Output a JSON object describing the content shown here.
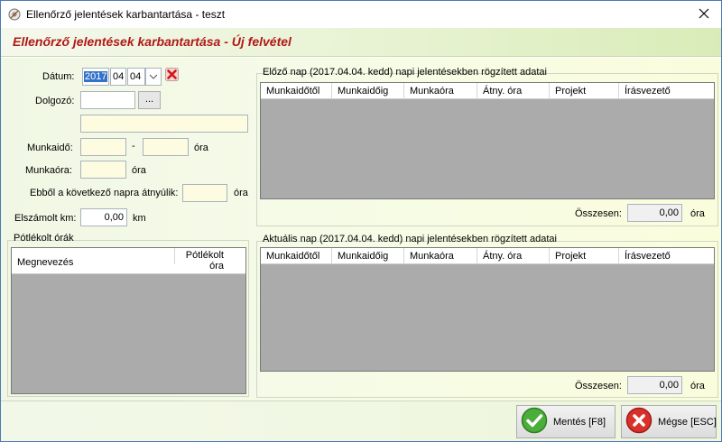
{
  "window": {
    "title": "Ellenőrző jelentések karbantartása - teszt",
    "heading": "Ellenőrző jelentések karbantartása - Új felvétel"
  },
  "form": {
    "datum_label": "Dátum:",
    "date_year": "2017",
    "date_month": "04",
    "date_day": "04",
    "dolgozo_label": "Dolgozó:",
    "dolgozo_code": "",
    "browse_label": "...",
    "dolgozo_name": "",
    "munkaido_label": "Munkaidő:",
    "munkaido_from": "",
    "munkaido_sep": "-",
    "munkaido_to": "",
    "munkaido_unit": "óra",
    "munkaora_label": "Munkaóra:",
    "munkaora_value": "",
    "munkaora_unit": "óra",
    "atnyulik_label": "Ebből a következő napra átnyúlik:",
    "atnyulik_value": "",
    "atnyulik_unit": "óra",
    "km_label": "Elszámolt km:",
    "km_value": "0,00",
    "km_unit": "km"
  },
  "potlek": {
    "title": "Pótlékolt órák",
    "col_name": "Megnevezés",
    "col_hours_1": "Pótlékolt",
    "col_hours_2": "óra"
  },
  "prev_day": {
    "title": "Előző nap (2017.04.04. kedd) napi jelentésekben rögzített adatai",
    "columns": [
      "Munkaidőtől",
      "Munkaidőig",
      "Munkaóra",
      "Átny. óra",
      "Projekt",
      "Írásvezető"
    ],
    "total_label": "Összesen:",
    "total_value": "0,00",
    "total_unit": "óra"
  },
  "cur_day": {
    "title": "Aktuális nap (2017.04.04. kedd) napi jelentésekben rögzített adatai",
    "columns": [
      "Munkaidőtől",
      "Munkaidőig",
      "Munkaóra",
      "Átny. óra",
      "Projekt",
      "Írásvezető"
    ],
    "total_label": "Összesen:",
    "total_value": "0,00",
    "total_unit": "óra"
  },
  "buttons": {
    "save": "Mentés [F8]",
    "cancel": "Mégse [ESC]"
  },
  "icons": {
    "app": "app-icon",
    "close": "close-icon",
    "clear": "red-x-icon",
    "save": "green-check-icon",
    "cancel": "red-cancel-icon"
  },
  "colors": {
    "heading": "#b01818",
    "grid_bg": "#ababab",
    "input_yellow": "#fdfbe0"
  }
}
